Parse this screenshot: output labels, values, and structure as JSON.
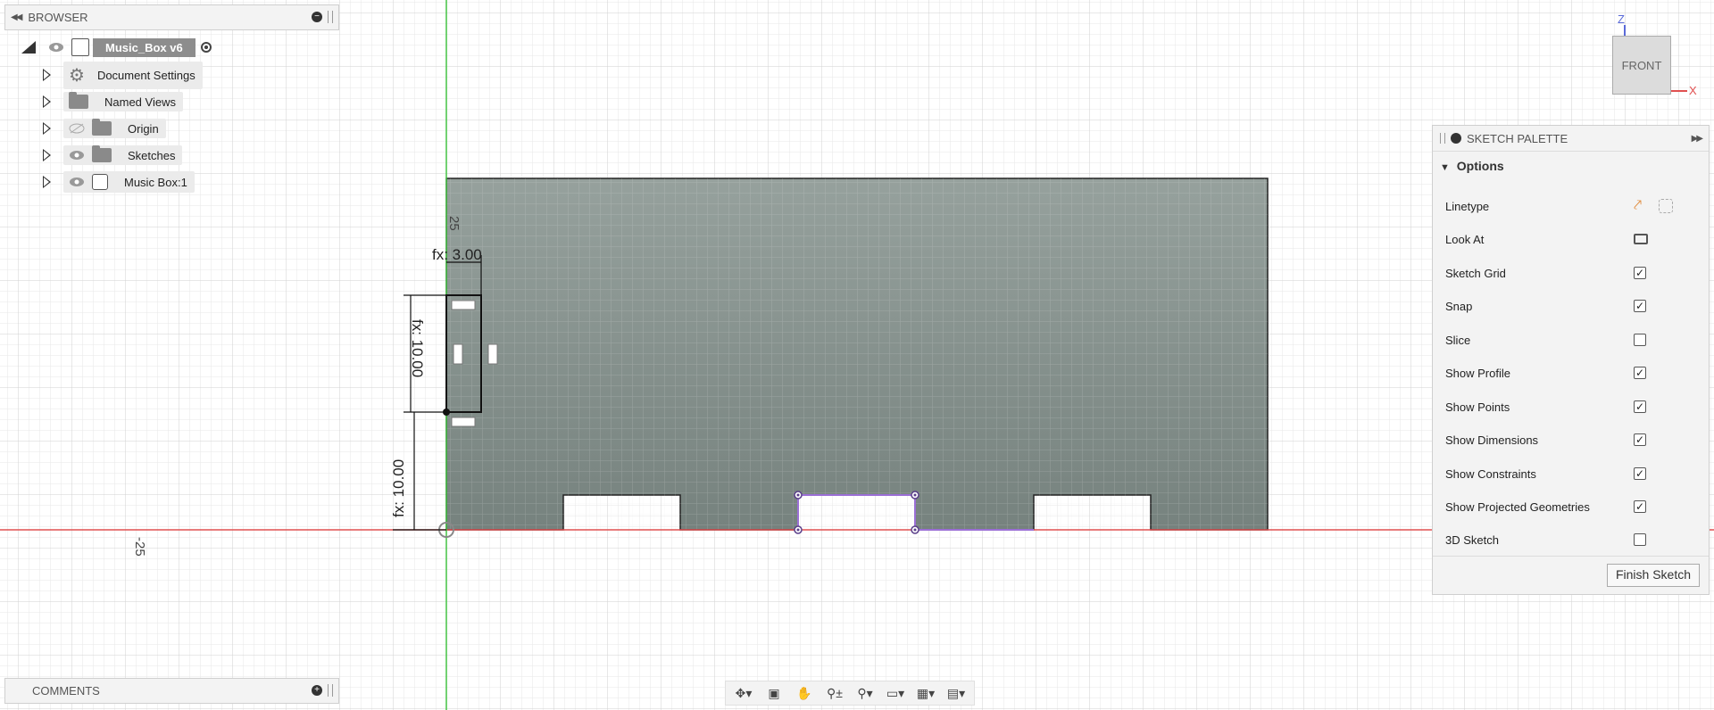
{
  "browser": {
    "title": "BROWSER",
    "root_label": "Music_Box v6",
    "items": [
      {
        "label": "Document Settings"
      },
      {
        "label": "Named Views"
      },
      {
        "label": "Origin"
      },
      {
        "label": "Sketches"
      },
      {
        "label": "Music Box:1"
      }
    ]
  },
  "comments": {
    "title": "COMMENTS"
  },
  "viewcube": {
    "face": "FRONT",
    "axis_z": "Z",
    "axis_x": "X"
  },
  "palette": {
    "title": "SKETCH PALETTE",
    "section": "Options",
    "rows": [
      {
        "label": "Linetype"
      },
      {
        "label": "Look At"
      },
      {
        "label": "Sketch Grid",
        "checked": true
      },
      {
        "label": "Snap",
        "checked": true
      },
      {
        "label": "Slice",
        "checked": false
      },
      {
        "label": "Show Profile",
        "checked": true
      },
      {
        "label": "Show Points",
        "checked": true
      },
      {
        "label": "Show Dimensions",
        "checked": true
      },
      {
        "label": "Show Constraints",
        "checked": true
      },
      {
        "label": "Show Projected Geometries",
        "checked": true
      },
      {
        "label": "3D Sketch",
        "checked": false
      }
    ],
    "finish_label": "Finish Sketch"
  },
  "dimensions": {
    "width_label": "fx: 3.00",
    "height_label": "fx: 10.00",
    "offset_label": "fx: 10.00",
    "top_label": "25",
    "axis_label": "-25"
  },
  "colors": {
    "sketch_fill": "#7f8a86",
    "x_axis": "#e05050",
    "y_axis": "#44c444",
    "selection": "#9b6fd6"
  }
}
